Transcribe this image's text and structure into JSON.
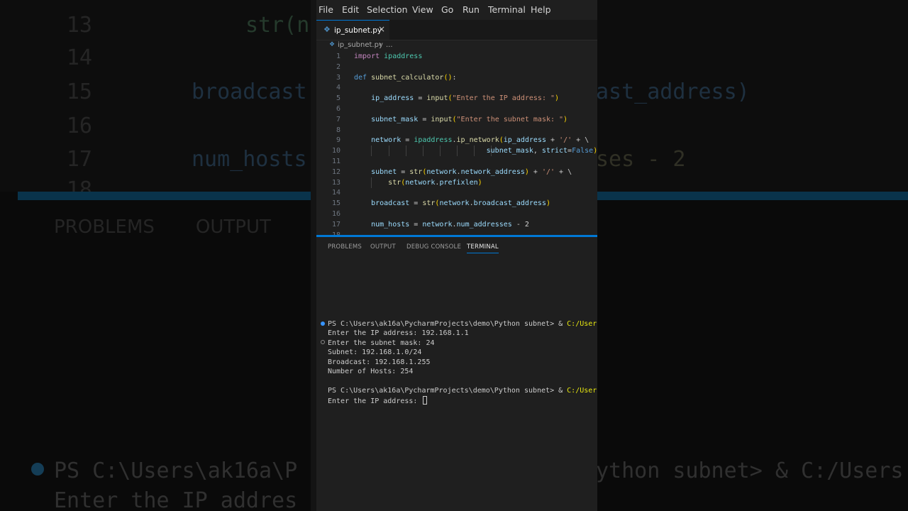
{
  "menu": [
    "File",
    "Edit",
    "Selection",
    "View",
    "Go",
    "Run",
    "Terminal",
    "Help"
  ],
  "tab": {
    "filename": "ip_subnet.py",
    "close": "×"
  },
  "breadcrumb": {
    "file": "ip_subnet.py",
    "sep": "›",
    "more": "..."
  },
  "code_lines": [
    {
      "n": "1",
      "html": "<span class='kw'>import</span> <span class='mod'>ipaddress</span>"
    },
    {
      "n": "2",
      "html": ""
    },
    {
      "n": "3",
      "html": "<span class='kw2'>def</span> <span class='fn'>subnet_calculator</span><span class='par'>()</span>:"
    },
    {
      "n": "4",
      "html": ""
    },
    {
      "n": "5",
      "html": "    <span class='var'>ip_address</span> = <span class='fn'>input</span><span class='par'>(</span><span class='str'>\"Enter the IP address: \"</span><span class='par'>)</span>"
    },
    {
      "n": "6",
      "html": ""
    },
    {
      "n": "7",
      "html": "    <span class='var'>subnet_mask</span> = <span class='fn'>input</span><span class='par'>(</span><span class='str'>\"Enter the subnet mask: \"</span><span class='par'>)</span>"
    },
    {
      "n": "8",
      "html": ""
    },
    {
      "n": "9",
      "html": "    <span class='var'>network</span> = <span class='mod'>ipaddress</span>.<span class='fn'>ip_network</span><span class='par'>(</span><span class='var'>ip_address</span> + <span class='str'>'/'</span> + \\"
    },
    {
      "n": "10",
      "html": "                               <span class='var'>subnet_mask</span>, <span class='var'>strict</span>=<span class='kw2'>False</span><span class='par'>)</span>"
    },
    {
      "n": "11",
      "html": ""
    },
    {
      "n": "12",
      "html": "    <span class='var'>subnet</span> = <span class='fn'>str</span><span class='par'>(</span><span class='var'>network</span>.<span class='var'>network_address</span><span class='par'>)</span> + <span class='str'>'/'</span> + \\"
    },
    {
      "n": "13",
      "html": "        <span class='fn'>str</span><span class='par'>(</span><span class='var'>network</span>.<span class='var'>prefixlen</span><span class='par'>)</span>"
    },
    {
      "n": "14",
      "html": ""
    },
    {
      "n": "15",
      "html": "    <span class='var'>broadcast</span> = <span class='fn'>str</span><span class='par'>(</span><span class='var'>network</span>.<span class='var'>broadcast_address</span><span class='par'>)</span>"
    },
    {
      "n": "16",
      "html": ""
    },
    {
      "n": "17",
      "html": "    <span class='var'>num_hosts</span> = <span class='var'>network</span>.<span class='var'>num_addresses</span> - <span class='op'>2</span>"
    },
    {
      "n": "18",
      "html": ""
    }
  ],
  "panel_tabs": [
    "PROBLEMS",
    "OUTPUT",
    "DEBUG CONSOLE",
    "TERMINAL"
  ],
  "terminal": {
    "prompt_path": "PS C:\\Users\\ak16a\\PycharmProjects\\demo\\Python subnet> & ",
    "prompt_cmd": "C:/Users",
    "lines": [
      "Enter the IP address: 192.168.1.1",
      "Enter the subnet mask: 24",
      "Subnet: 192.168.1.0/24",
      "Broadcast: 192.168.1.255",
      "Number of Hosts: 254"
    ],
    "second_prompt_path": "PS C:\\Users\\ak16a\\PycharmProjects\\demo\\Python subnet> & ",
    "second_prompt_cmd": "C:/Users",
    "last_line": "Enter the IP address: "
  },
  "background": {
    "line_numbers": [
      "13",
      "14",
      "15",
      "16",
      "17",
      "18"
    ],
    "code": [
      "str(n",
      "broadcast",
      "num_hosts",
      "ast_address)",
      "ses - 2"
    ],
    "panel_tabs": [
      "PROBLEMS",
      "OUTPUT",
      "D"
    ],
    "term_line1": "PS C:\\Users\\ak16a\\P",
    "term_line1b": "ython subnet> & C:/Users",
    "term_line2": "Enter the IP addres"
  },
  "colors": {
    "accent": "#0078d4",
    "editor_bg": "#1f1f1f",
    "terminal_cmd": "#e5e510"
  }
}
